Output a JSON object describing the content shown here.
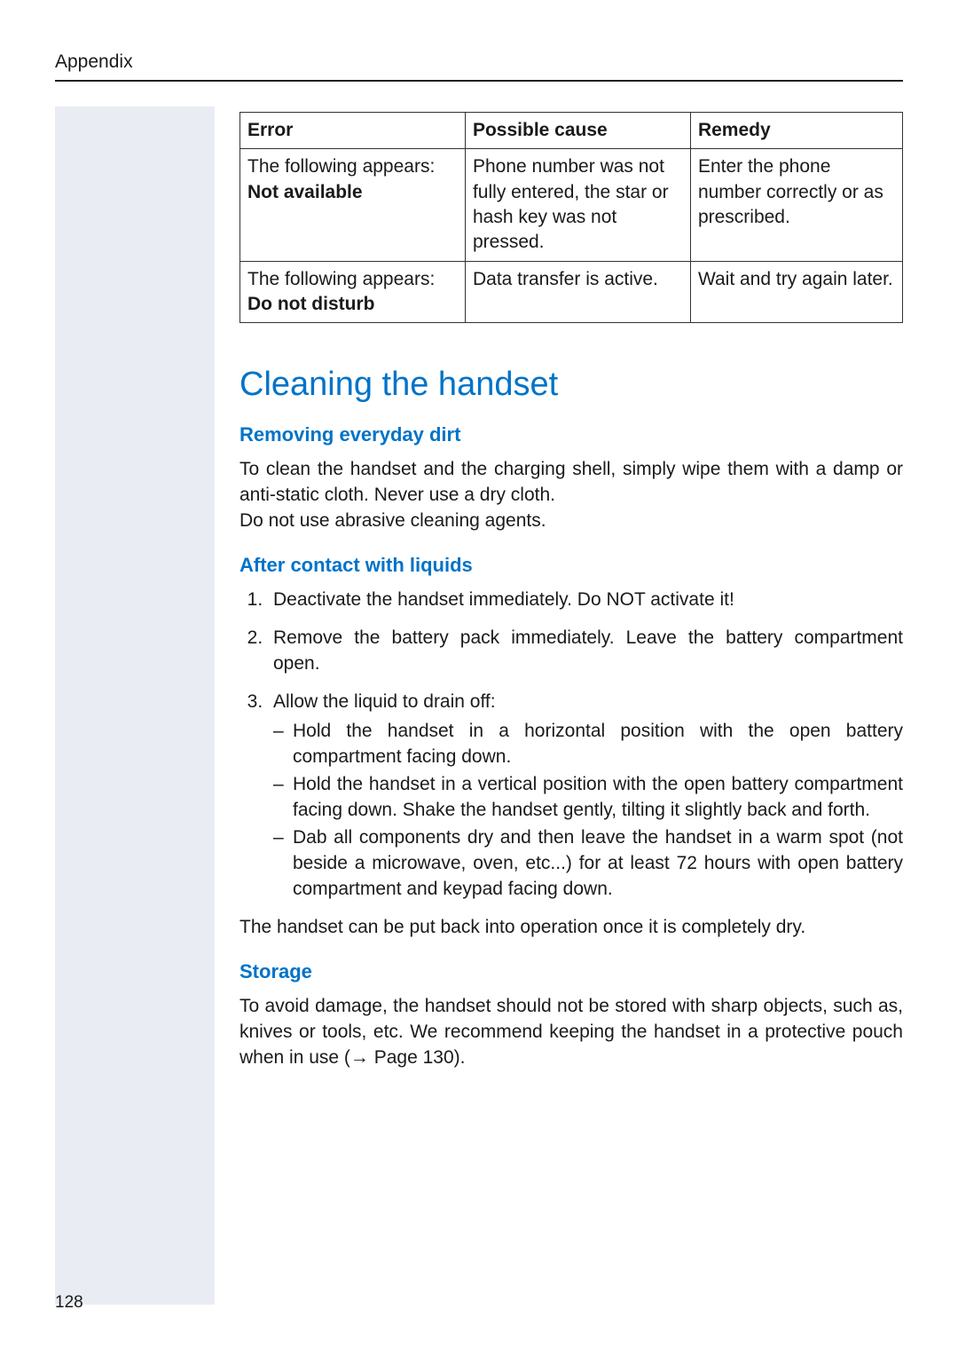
{
  "header": {
    "section_label": "Appendix",
    "page_number": "128"
  },
  "table": {
    "headers": {
      "error": "Error",
      "cause": "Possible cause",
      "remedy": "Remedy"
    },
    "rows": [
      {
        "error_prefix": "The following appears:",
        "error_bold": "Not available",
        "cause": "Phone number was not fully entered, the star or hash key was not pressed.",
        "remedy": "Enter the phone number correctly or as prescribed."
      },
      {
        "error_prefix": "The following appears:",
        "error_bold": "Do not disturb",
        "cause": "Data transfer is active.",
        "remedy": "Wait and try again later."
      }
    ]
  },
  "section": {
    "title": "Cleaning the handset",
    "sub1": {
      "heading": "Removing everyday dirt",
      "para": "To clean the handset and the charging shell, simply wipe them with a damp or anti-static cloth. Never use a dry cloth.\nDo not use abrasive cleaning agents."
    },
    "sub2": {
      "heading": "After contact with liquids",
      "steps": [
        "Deactivate the handset immediately. Do NOT activate it!",
        "Remove the battery pack immediately. Leave the battery compartment open.",
        "Allow the liquid to drain off:"
      ],
      "drain_items": [
        "Hold the handset in a horizontal position with the open battery compartment facing down.",
        "Hold the handset in a vertical position with the open battery compartment facing down. Shake the handset gently, tilting it slightly back and forth.",
        "Dab all components dry and then leave the handset in a warm spot (not beside a microwave, oven, etc...) for at least 72 hours with open battery compartment and keypad facing down."
      ],
      "closing": "The handset can be put back into operation once it is completely dry."
    },
    "sub3": {
      "heading": "Storage",
      "para_pre": "To avoid damage, the handset should not be stored with sharp objects, such as, knives or tools, etc. We recommend keeping the handset in a protective pouch when in use (",
      "page_ref": " Page 130",
      "para_post": ")."
    }
  }
}
